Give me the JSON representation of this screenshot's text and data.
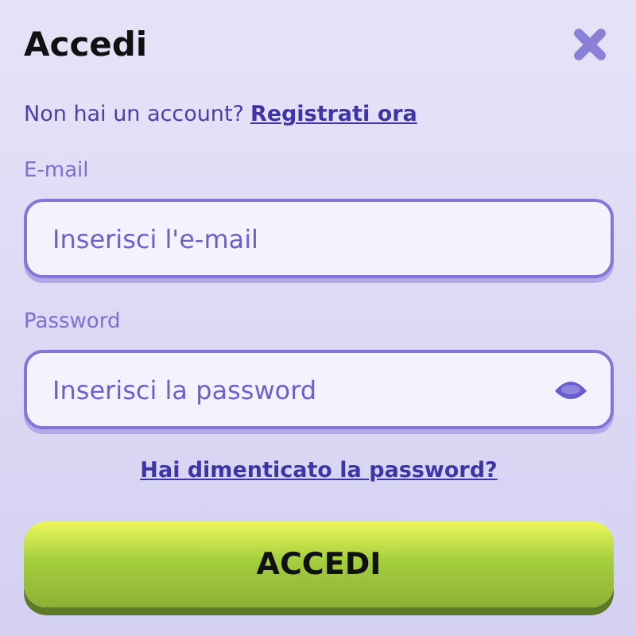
{
  "title": "Accedi",
  "register": {
    "prompt": "Non hai un account?",
    "link": "Registrati ora"
  },
  "fields": [
    {
      "label": "E-mail",
      "placeholder": "Inserisci l'e-mail",
      "kind": "email"
    },
    {
      "label": "Password",
      "placeholder": "Inserisci la password",
      "kind": "password"
    }
  ],
  "forgot_link": "Hai dimenticato la password?",
  "submit": "ACCEDI"
}
